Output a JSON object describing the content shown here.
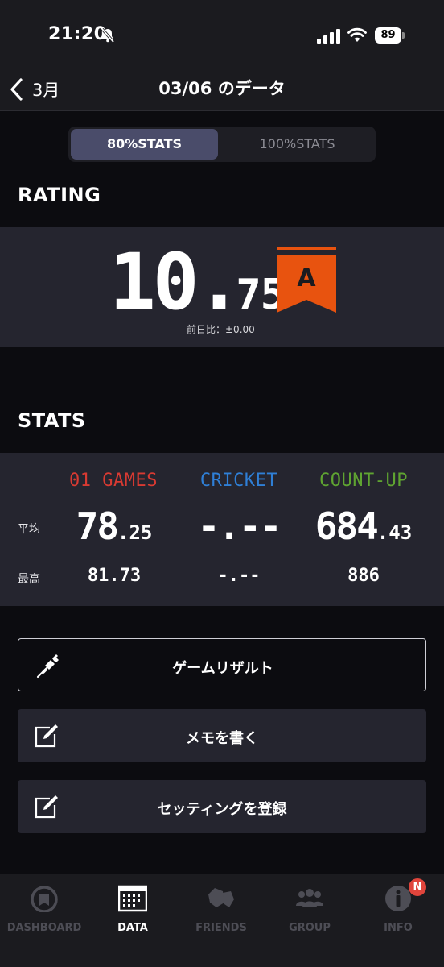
{
  "status_bar": {
    "time": "21:20",
    "battery": "89"
  },
  "nav": {
    "back_label": "3月",
    "title": "03/06 のデータ"
  },
  "segmented": {
    "active": "80%STATS",
    "inactive": "100%STATS"
  },
  "rating": {
    "heading": "RATING",
    "value_int": "10",
    "value_dot": ".",
    "value_dec": "75",
    "diff": "前日比：±0.00",
    "grade": "A",
    "grade_color": "#e8530f"
  },
  "stats": {
    "heading": "STATS",
    "row_avg_label": "平均",
    "row_max_label": "最高",
    "columns": [
      {
        "name": "01 GAMES",
        "color": "#d93a32",
        "avg_int": "78",
        "avg_dec": ".25",
        "max": "81.73"
      },
      {
        "name": "CRICKET",
        "color": "#2f7fd6",
        "avg_int": "-.",
        "avg_dec": "--",
        "max": "-.--"
      },
      {
        "name": "COUNT-UP",
        "color": "#5fa431",
        "avg_int": "684",
        "avg_dec": ".43",
        "max": "886"
      }
    ]
  },
  "actions": [
    {
      "label": "ゲームリザルト",
      "icon": "dart-icon"
    },
    {
      "label": "メモを書く",
      "icon": "edit-icon"
    },
    {
      "label": "セッティングを登録",
      "icon": "edit-icon"
    }
  ],
  "tabs": [
    {
      "label": "DASHBOARD",
      "icon": "dashboard-icon",
      "active": false
    },
    {
      "label": "DATA",
      "icon": "calendar-icon",
      "active": true
    },
    {
      "label": "FRIENDS",
      "icon": "friends-icon",
      "active": false
    },
    {
      "label": "GROUP",
      "icon": "group-icon",
      "active": false
    },
    {
      "label": "INFO",
      "icon": "info-icon",
      "active": false
    }
  ],
  "info_badge": "N"
}
